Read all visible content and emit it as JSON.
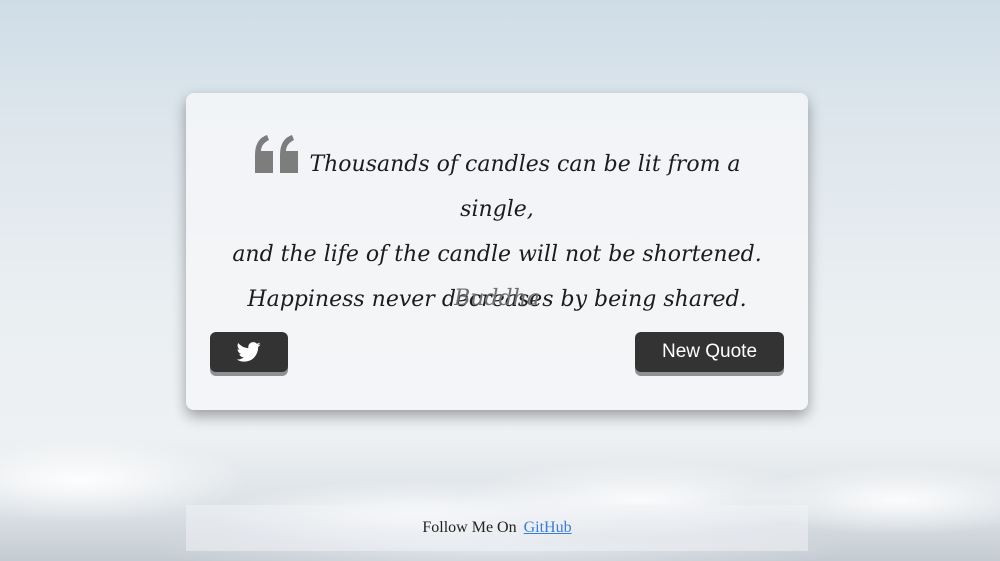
{
  "quote": {
    "lines": [
      "Thousands of candles can be lit from a single,",
      "and the life of the candle will not be shortened.",
      "Happiness never decreases by being shared."
    ],
    "author": "Buddha",
    "icon": "quote-left-icon"
  },
  "buttons": {
    "tweet_icon": "twitter-icon",
    "new_quote_label": "New Quote"
  },
  "footer": {
    "text": "Follow Me On",
    "link_label": "GitHub"
  },
  "colors": {
    "button_bg": "#333333",
    "link": "#3b7ed9",
    "author_text": "#6f6f6f"
  }
}
